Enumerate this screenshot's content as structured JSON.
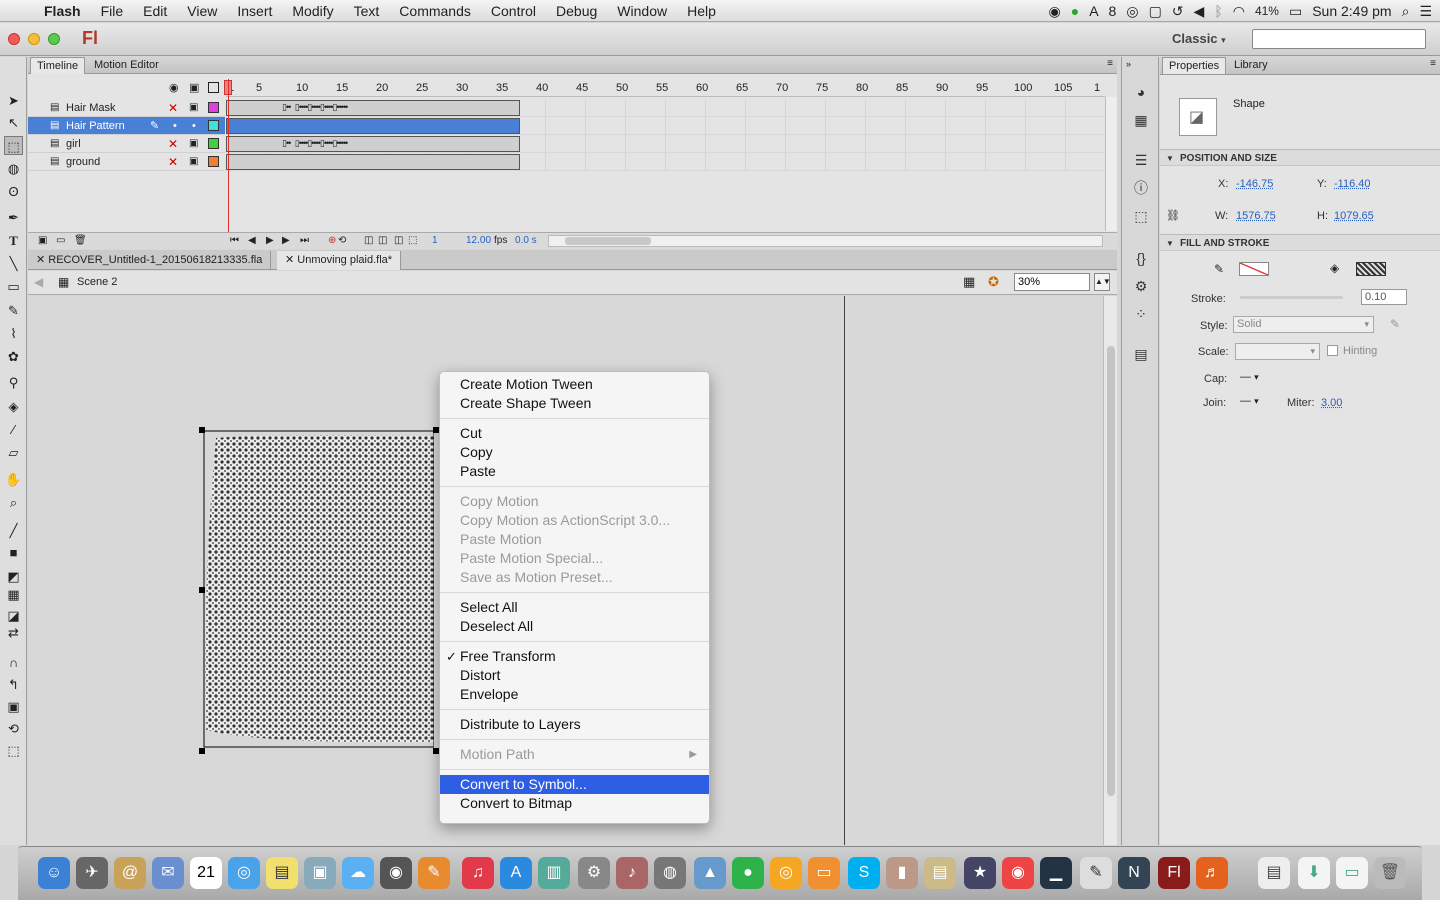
{
  "menubar": {
    "app": "Flash",
    "items": [
      "File",
      "Edit",
      "View",
      "Insert",
      "Modify",
      "Text",
      "Commands",
      "Control",
      "Debug",
      "Window",
      "Help"
    ],
    "status_num": "8",
    "battery": "41%",
    "clock": "Sun 2:49 pm"
  },
  "appbar": {
    "logo": "Fl",
    "workspace": "Classic"
  },
  "timeline": {
    "tabs": [
      "Timeline",
      "Motion Editor"
    ],
    "ruler": [
      "1",
      "5",
      "10",
      "15",
      "20",
      "25",
      "30",
      "35",
      "40",
      "45",
      "50",
      "55",
      "60",
      "65",
      "70",
      "75",
      "80",
      "85",
      "90",
      "95",
      "100",
      "105",
      "1"
    ],
    "layers": [
      {
        "name": "Hair Mask",
        "color": "#e040e0"
      },
      {
        "name": "Hair Pattern",
        "color": "#40e0e0"
      },
      {
        "name": "girl",
        "color": "#40d040"
      },
      {
        "name": "ground",
        "color": "#f08030"
      }
    ],
    "status": {
      "frame": "1",
      "fps": "12.00",
      "fps_unit": "fps",
      "time": "0.0 s"
    }
  },
  "doc_tabs": [
    "RECOVER_Untitled-1_20150618213335.fla",
    "Unmoving plaid.fla*"
  ],
  "edit_bar": {
    "scene": "Scene 2",
    "zoom": "30%"
  },
  "context_menu": [
    {
      "label": "Create Motion Tween",
      "state": "normal"
    },
    {
      "label": "Create Shape Tween",
      "state": "normal"
    },
    {
      "sep": true
    },
    {
      "label": "Cut",
      "state": "normal"
    },
    {
      "label": "Copy",
      "state": "normal"
    },
    {
      "label": "Paste",
      "state": "normal"
    },
    {
      "sep": true
    },
    {
      "label": "Copy Motion",
      "state": "disabled"
    },
    {
      "label": "Copy Motion as ActionScript 3.0...",
      "state": "disabled"
    },
    {
      "label": "Paste Motion",
      "state": "disabled"
    },
    {
      "label": "Paste Motion Special...",
      "state": "disabled"
    },
    {
      "label": "Save as Motion Preset...",
      "state": "disabled"
    },
    {
      "sep": true
    },
    {
      "label": "Select All",
      "state": "normal"
    },
    {
      "label": "Deselect All",
      "state": "normal"
    },
    {
      "sep": true
    },
    {
      "label": "Free Transform",
      "state": "checked"
    },
    {
      "label": "Distort",
      "state": "normal"
    },
    {
      "label": "Envelope",
      "state": "normal"
    },
    {
      "sep": true
    },
    {
      "label": "Distribute to Layers",
      "state": "normal"
    },
    {
      "sep": true
    },
    {
      "label": "Motion Path",
      "state": "disabled-submenu"
    },
    {
      "sep": true
    },
    {
      "label": "Convert to Symbol...",
      "state": "highlighted"
    },
    {
      "label": "Convert to Bitmap",
      "state": "normal"
    }
  ],
  "properties": {
    "tabs": [
      "Properties",
      "Library"
    ],
    "type": "Shape",
    "position_size": {
      "header": "POSITION AND SIZE",
      "x_label": "X:",
      "x": "-146.75",
      "y_label": "Y:",
      "y": "-116.40",
      "w_label": "W:",
      "w": "1576.75",
      "h_label": "H:",
      "h": "1079.65"
    },
    "fill_stroke": {
      "header": "FILL AND STROKE",
      "stroke_label": "Stroke:",
      "stroke": "0.10",
      "style_label": "Style:",
      "style": "Solid",
      "scale_label": "Scale:",
      "hinting": "Hinting",
      "cap_label": "Cap:",
      "join_label": "Join:",
      "miter_label": "Miter:",
      "miter": "3.00"
    }
  },
  "colors": {
    "accent": "#2d5ee3",
    "layer_select": "#4a7fd6"
  }
}
